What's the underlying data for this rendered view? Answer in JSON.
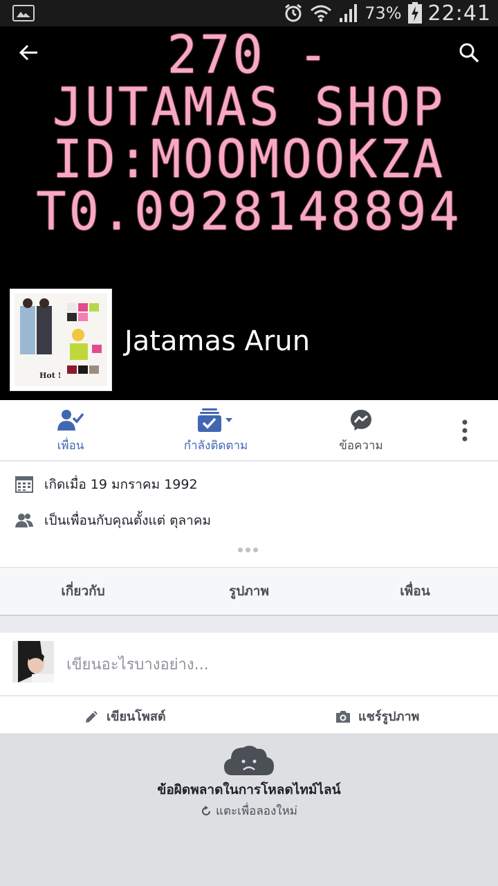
{
  "status_bar": {
    "battery_percent": "73%",
    "time": "22:41"
  },
  "cover": {
    "lines": [
      "270 -",
      "JUTAMAS SHOP",
      "ID:MOOMOOKZA",
      "T0.0928148894"
    ]
  },
  "profile": {
    "name": "Jatamas Arun",
    "profile_pic_caption": "Hot !"
  },
  "actions": {
    "friends_label": "เพื่อน",
    "following_label": "กำลังติดตาม",
    "message_label": "ข้อความ"
  },
  "info": {
    "birthday": "เกิดเมื่อ 19 มกราคม 1992",
    "friends_since": "เป็นเพื่อนกับคุณตั้งแต่ ตุลาคม"
  },
  "tabs": [
    "เกี่ยวกับ",
    "รูปภาพ",
    "เพื่อน"
  ],
  "composer": {
    "placeholder": "เขียนอะไรบางอย่าง...",
    "write_post": "เขียนโพสต์",
    "share_photo": "แชร์รูปภาพ"
  },
  "error": {
    "title": "ข้อผิดพลาดในการโหลดไทม์ไลน์",
    "retry": "แตะเพื่อลองใหม่"
  },
  "colors": {
    "accent": "#4267b2",
    "cover_text": "#f7a9c4",
    "background": "#e9ebee"
  }
}
